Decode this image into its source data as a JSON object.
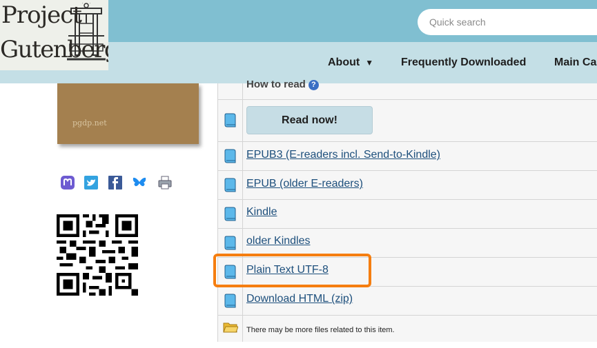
{
  "header": {
    "logo": {
      "line1": "Project",
      "line2": "Gutenberg"
    },
    "search": {
      "placeholder": "Quick search"
    },
    "nav": [
      {
        "label": "About",
        "caret": "▼"
      },
      {
        "label": "Frequently Downloaded"
      },
      {
        "label": "Main Ca"
      }
    ]
  },
  "cover": {
    "text": "pgdp.net"
  },
  "share_icons": [
    "mastodon-icon",
    "twitter-icon",
    "facebook-icon",
    "bluesky-icon",
    "print-icon"
  ],
  "files": {
    "howto": {
      "label": "How to read",
      "help": "?"
    },
    "read_now": "Read now!",
    "links": [
      "EPUB3 (E-readers incl. Send-to-Kindle)",
      "EPUB (older E-readers)",
      "Kindle",
      "older Kindles",
      "Plain Text UTF-8",
      "Download HTML (zip)"
    ],
    "more_note": "There may be more files related to this item."
  },
  "colors": {
    "header_top": "#80bfd1",
    "header_bottom": "#c4dfe6",
    "link": "#1d4f7c",
    "highlight": "#f57e10"
  }
}
